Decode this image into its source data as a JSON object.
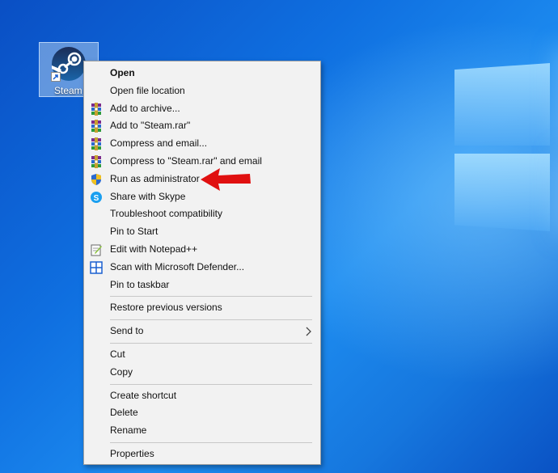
{
  "desktop": {
    "icon_label": "Steam",
    "accent": "#0f6fe0"
  },
  "menu": {
    "group1": [
      {
        "label": "Open",
        "bold": true,
        "icon": ""
      },
      {
        "label": "Open file location",
        "icon": ""
      },
      {
        "label": "Add to archive...",
        "icon": "winrar-icon"
      },
      {
        "label": "Add to \"Steam.rar\"",
        "icon": "winrar-icon"
      },
      {
        "label": "Compress and email...",
        "icon": "winrar-icon"
      },
      {
        "label": "Compress to \"Steam.rar\" and email",
        "icon": "winrar-icon"
      },
      {
        "label": "Run as administrator",
        "icon": "uac-shield-icon"
      },
      {
        "label": "Share with Skype",
        "icon": "skype-icon"
      },
      {
        "label": "Troubleshoot compatibility",
        "icon": ""
      },
      {
        "label": "Pin to Start",
        "icon": ""
      },
      {
        "label": "Edit with Notepad++",
        "icon": "notepad-plus-plus-icon"
      },
      {
        "label": "Scan with Microsoft Defender...",
        "icon": "defender-icon"
      },
      {
        "label": "Pin to taskbar",
        "icon": ""
      }
    ],
    "group2": [
      {
        "label": "Restore previous versions"
      }
    ],
    "group3": [
      {
        "label": "Send to",
        "submenu_icon": "chevron-right-icon"
      }
    ],
    "group4": [
      {
        "label": "Cut"
      },
      {
        "label": "Copy"
      }
    ],
    "group5": [
      {
        "label": "Create shortcut"
      },
      {
        "label": "Delete"
      },
      {
        "label": "Rename"
      }
    ],
    "group6": [
      {
        "label": "Properties"
      }
    ]
  },
  "annotation": {
    "icon": "red-arrow-icon",
    "color": "#e01010"
  }
}
